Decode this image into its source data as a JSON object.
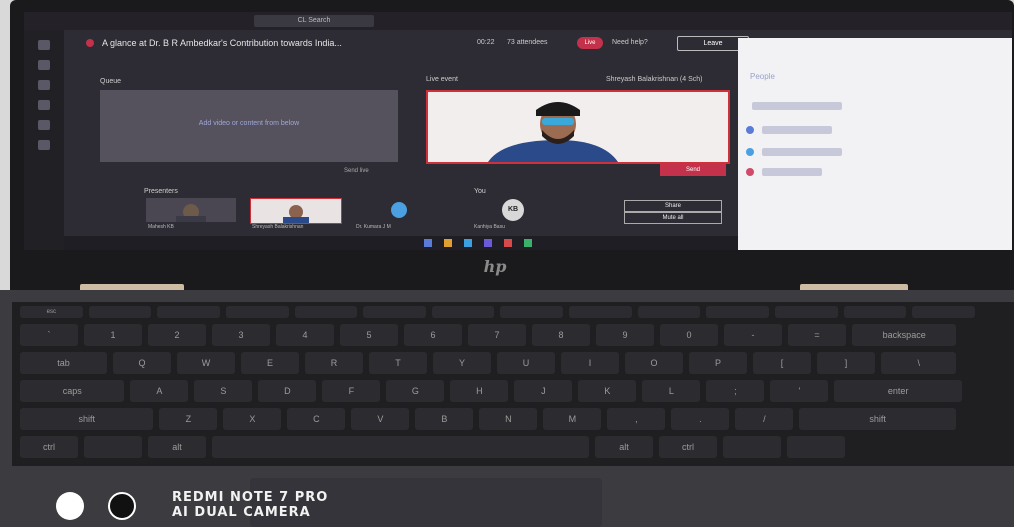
{
  "meeting": {
    "window_title": "CL Search",
    "event_title": "A glance at Dr. B R Ambedkar's Contribution towards India...",
    "time": "00:22",
    "attendees": "73 attendees",
    "live_badge": "Live",
    "need_help": "Need help?",
    "leave_label": "Leave",
    "queue_label": "Queue",
    "live_event_label": "Live event",
    "queue_message": "Add video or content from below",
    "presenter_name": "Shreyash Balakrishnan (4 Sch)",
    "send_live_label": "Send",
    "send_live_small": "Send live",
    "presenters_label": "Presenters",
    "you_label": "You",
    "thumb_names": [
      "Mahesh KB",
      "Shreyash Balakrishnan",
      "Dr. Kumara J M",
      "Kanhiya Basu"
    ],
    "avatar_initials": "KB",
    "share_label": "Share",
    "mute_all_label": "Mute all",
    "panel_title": "People"
  },
  "keyboard": {
    "fn_row": [
      "esc",
      "",
      "",
      "",
      "",
      "",
      "",
      "",
      "",
      "",
      "",
      "",
      "",
      "",
      ""
    ],
    "num_row": [
      "`",
      "1",
      "2",
      "3",
      "4",
      "5",
      "6",
      "7",
      "8",
      "9",
      "0",
      "-",
      "=",
      "backspace"
    ],
    "q_row": [
      "tab",
      "Q",
      "W",
      "E",
      "R",
      "T",
      "Y",
      "U",
      "I",
      "O",
      "P",
      "[",
      "]",
      "\\"
    ],
    "a_row": [
      "caps",
      "A",
      "S",
      "D",
      "F",
      "G",
      "H",
      "J",
      "K",
      "L",
      ";",
      "'",
      "enter"
    ],
    "z_row": [
      "shift",
      "Z",
      "X",
      "C",
      "V",
      "B",
      "N",
      "M",
      ",",
      ".",
      "/",
      "shift"
    ],
    "bottom_row": [
      "ctrl",
      "",
      "alt",
      "",
      "alt",
      "ctrl",
      "",
      ""
    ]
  },
  "watermark": {
    "line1": "REDMI NOTE 7 PRO",
    "line2": "AI DUAL CAMERA"
  },
  "colors": {
    "accent_red": "#c4314b",
    "link_purple": "#9fa6d8"
  }
}
